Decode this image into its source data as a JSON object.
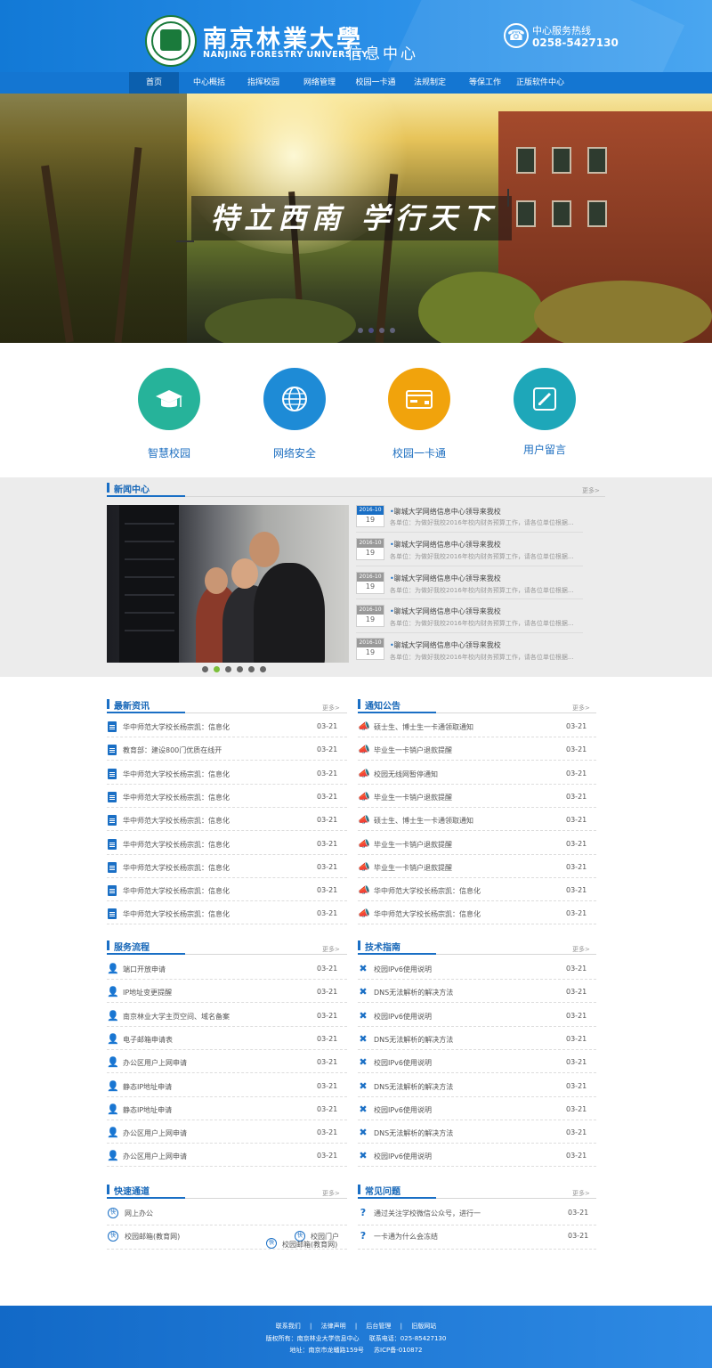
{
  "header": {
    "university_cn": "南京林業大學",
    "university_en": "NANJING FORESTRY UNIVERSITY",
    "subtitle": "信息中心",
    "hotline_label": "中心服务热线",
    "hotline_number": "0258-5427130"
  },
  "nav": {
    "items": [
      "首页",
      "中心概括",
      "指挥校园",
      "网络管理",
      "校园一卡通",
      "法规制定",
      "等保工作",
      "正版软件中心"
    ],
    "active": "首页"
  },
  "banner": {
    "slogan": "特立西南  学行天下"
  },
  "services": [
    {
      "label": "智慧校园",
      "icon": "graduation-cap-icon",
      "color": "#26b39a"
    },
    {
      "label": "网络安全",
      "icon": "globe-icon",
      "color": "#1e8bd6"
    },
    {
      "label": "校园一卡通",
      "icon": "card-icon",
      "color": "#f1a30c"
    },
    {
      "label": "用户留言",
      "icon": "edit-icon",
      "color": "#1ea7b9"
    }
  ],
  "news_center": {
    "title": "新闻中心",
    "more": "更多>",
    "items": [
      {
        "year": "2016-10",
        "day": "19",
        "title": "聊城大学网络信息中心领导来我校",
        "summary": "各单位：为做好我校2016年校内财务预算工作，请各位单位根据..."
      },
      {
        "year": "2016-10",
        "day": "19",
        "title": "聊城大学网络信息中心领导来我校",
        "summary": "各单位：为做好我校2016年校内财务预算工作，请各位单位根据..."
      },
      {
        "year": "2016-10",
        "day": "19",
        "title": "聊城大学网络信息中心领导来我校",
        "summary": "各单位：为做好我校2016年校内财务预算工作，请各位单位根据..."
      },
      {
        "year": "2016-10",
        "day": "19",
        "title": "聊城大学网络信息中心领导来我校",
        "summary": "各单位：为做好我校2016年校内财务预算工作，请各位单位根据..."
      },
      {
        "year": "2016-10",
        "day": "19",
        "title": "聊城大学网络信息中心领导来我校",
        "summary": "各单位：为做好我校2016年校内财务预算工作，请各位单位根据..."
      }
    ]
  },
  "latest_news": {
    "title": "最新资讯",
    "more": "更多>",
    "items": [
      {
        "text": "华中师范大学校长杨宗凯：信息化",
        "date": "03-21"
      },
      {
        "text": "教育部：建设800门优质在线开",
        "date": "03-21"
      },
      {
        "text": "华中师范大学校长杨宗凯：信息化",
        "date": "03-21"
      },
      {
        "text": "华中师范大学校长杨宗凯：信息化",
        "date": "03-21"
      },
      {
        "text": "华中师范大学校长杨宗凯：信息化",
        "date": "03-21"
      },
      {
        "text": "华中师范大学校长杨宗凯：信息化",
        "date": "03-21"
      },
      {
        "text": "华中师范大学校长杨宗凯：信息化",
        "date": "03-21"
      },
      {
        "text": "华中师范大学校长杨宗凯：信息化",
        "date": "03-21"
      },
      {
        "text": "华中师范大学校长杨宗凯：信息化",
        "date": "03-21"
      }
    ]
  },
  "notices": {
    "title": "通知公告",
    "more": "更多>",
    "items": [
      {
        "text": "硕士生、博士生一卡通领取通知",
        "date": "03-21"
      },
      {
        "text": "毕业生一卡销户退款提醒",
        "date": "03-21"
      },
      {
        "text": "校园无线网暂停通知",
        "date": "03-21"
      },
      {
        "text": "毕业生一卡销户退款提醒",
        "date": "03-21"
      },
      {
        "text": "硕士生、博士生一卡通领取通知",
        "date": "03-21"
      },
      {
        "text": "毕业生一卡销户退款提醒",
        "date": "03-21"
      },
      {
        "text": "毕业生一卡销户退款提醒",
        "date": "03-21"
      },
      {
        "text": "华中师范大学校长杨宗凯：信息化",
        "date": "03-21"
      },
      {
        "text": "华中师范大学校长杨宗凯：信息化",
        "date": "03-21"
      }
    ]
  },
  "service_process": {
    "title": "服务流程",
    "more": "更多>",
    "items": [
      {
        "text": "端口开放申请",
        "date": "03-21"
      },
      {
        "text": "IP地址变更提醒",
        "date": "03-21"
      },
      {
        "text": "南京林业大学主页空间、域名备案",
        "date": "03-21"
      },
      {
        "text": "电子邮箱申请表",
        "date": "03-21"
      },
      {
        "text": "办公区用户上网申请",
        "date": "03-21"
      },
      {
        "text": "静态IP地址申请",
        "date": "03-21"
      },
      {
        "text": "静态IP地址申请",
        "date": "03-21"
      },
      {
        "text": "办公区用户上网申请",
        "date": "03-21"
      },
      {
        "text": "办公区用户上网申请",
        "date": "03-21"
      }
    ]
  },
  "tech_guide": {
    "title": "技术指南",
    "more": "更多>",
    "items": [
      {
        "text": "校园IPv6使用说明",
        "date": "03-21"
      },
      {
        "text": "DNS无法解析的解决方法",
        "date": "03-21"
      },
      {
        "text": "校园IPv6使用说明",
        "date": "03-21"
      },
      {
        "text": "DNS无法解析的解决方法",
        "date": "03-21"
      },
      {
        "text": "校园IPv6使用说明",
        "date": "03-21"
      },
      {
        "text": "DNS无法解析的解决方法",
        "date": "03-21"
      },
      {
        "text": "校园IPv6使用说明",
        "date": "03-21"
      },
      {
        "text": "DNS无法解析的解决方法",
        "date": "03-21"
      },
      {
        "text": "校园IPv6使用说明",
        "date": "03-21"
      }
    ]
  },
  "quick_links": {
    "title": "快速通道",
    "more": "更多>",
    "badge": "快",
    "items": [
      "网上办公",
      "校园邮箱(教育网)",
      "校园门户",
      "校园邮箱(教育网)"
    ]
  },
  "faq": {
    "title": "常见问题",
    "more": "更多>",
    "items": [
      {
        "text": "通过关注学校微信公众号，进行一",
        "date": "03-21"
      },
      {
        "text": "一卡通为什么会冻结",
        "date": "03-21"
      }
    ]
  },
  "footer": {
    "links": [
      "联系我们",
      "|",
      "法律声明",
      "|",
      "后台管理",
      "|",
      "旧版网站"
    ],
    "copyright": "版权所有：南京林业大学信息中心",
    "phone": "联系电话：025-85427130",
    "address": "地址：南京市龙蟠路159号",
    "icp": "苏ICP备-010872"
  },
  "colors": {
    "brand_blue": "#1476d2",
    "nav_active": "#0b5fae",
    "section_blue": "#1a6fc5"
  }
}
